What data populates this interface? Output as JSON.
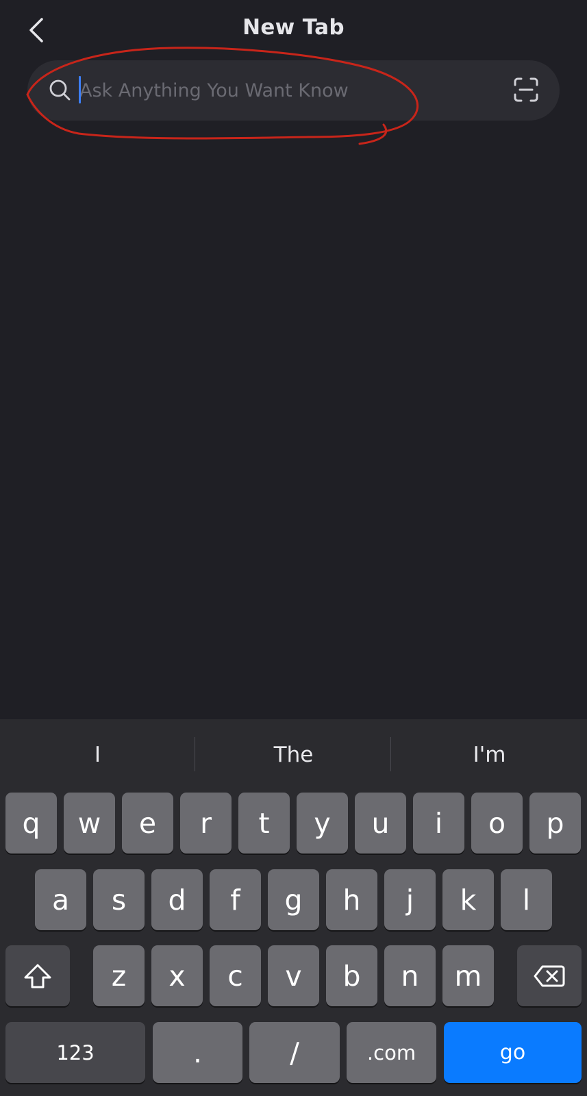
{
  "header": {
    "title": "New Tab"
  },
  "search": {
    "placeholder": "Ask Anything You Want Know",
    "value": ""
  },
  "keyboard": {
    "suggestions": [
      "I",
      "The",
      "I'm"
    ],
    "row1": [
      "q",
      "w",
      "e",
      "r",
      "t",
      "y",
      "u",
      "i",
      "o",
      "p"
    ],
    "row2": [
      "a",
      "s",
      "d",
      "f",
      "g",
      "h",
      "j",
      "k",
      "l"
    ],
    "row3": [
      "z",
      "x",
      "c",
      "v",
      "b",
      "n",
      "m"
    ],
    "bottom": {
      "numbers": "123",
      "period": ".",
      "slash": "/",
      "dotcom": ".com",
      "go": "go"
    }
  },
  "colors": {
    "background": "#1f1f25",
    "search_bg": "#2c2c32",
    "annotation": "#c8251a",
    "caret": "#3d7ff7",
    "key": "#6b6b70",
    "key_dark": "#47474c",
    "go_key": "#0a7bff"
  },
  "icons": {
    "back": "chevron-left-icon",
    "search": "search-icon",
    "scan": "scan-icon",
    "shift": "shift-icon",
    "backspace": "backspace-icon"
  }
}
